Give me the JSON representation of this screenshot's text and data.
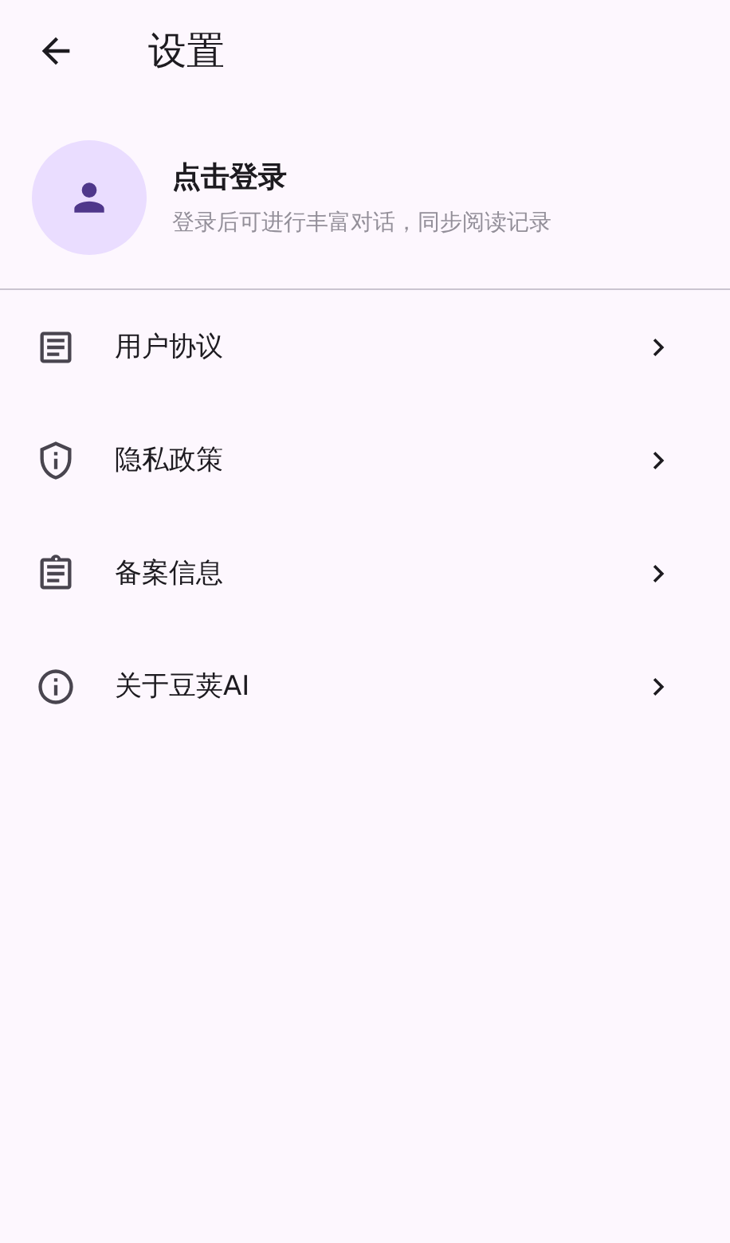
{
  "top_bar": {
    "title": "设置"
  },
  "profile": {
    "title": "点击登录",
    "subtitle": "登录后可进行丰富对话，同步阅读记录"
  },
  "menu": [
    {
      "kind": "document",
      "label": "用户协议"
    },
    {
      "kind": "shield",
      "label": "隐私政策"
    },
    {
      "kind": "clipboard",
      "label": "备案信息"
    },
    {
      "kind": "info",
      "label": "关于豆荚AI"
    }
  ]
}
